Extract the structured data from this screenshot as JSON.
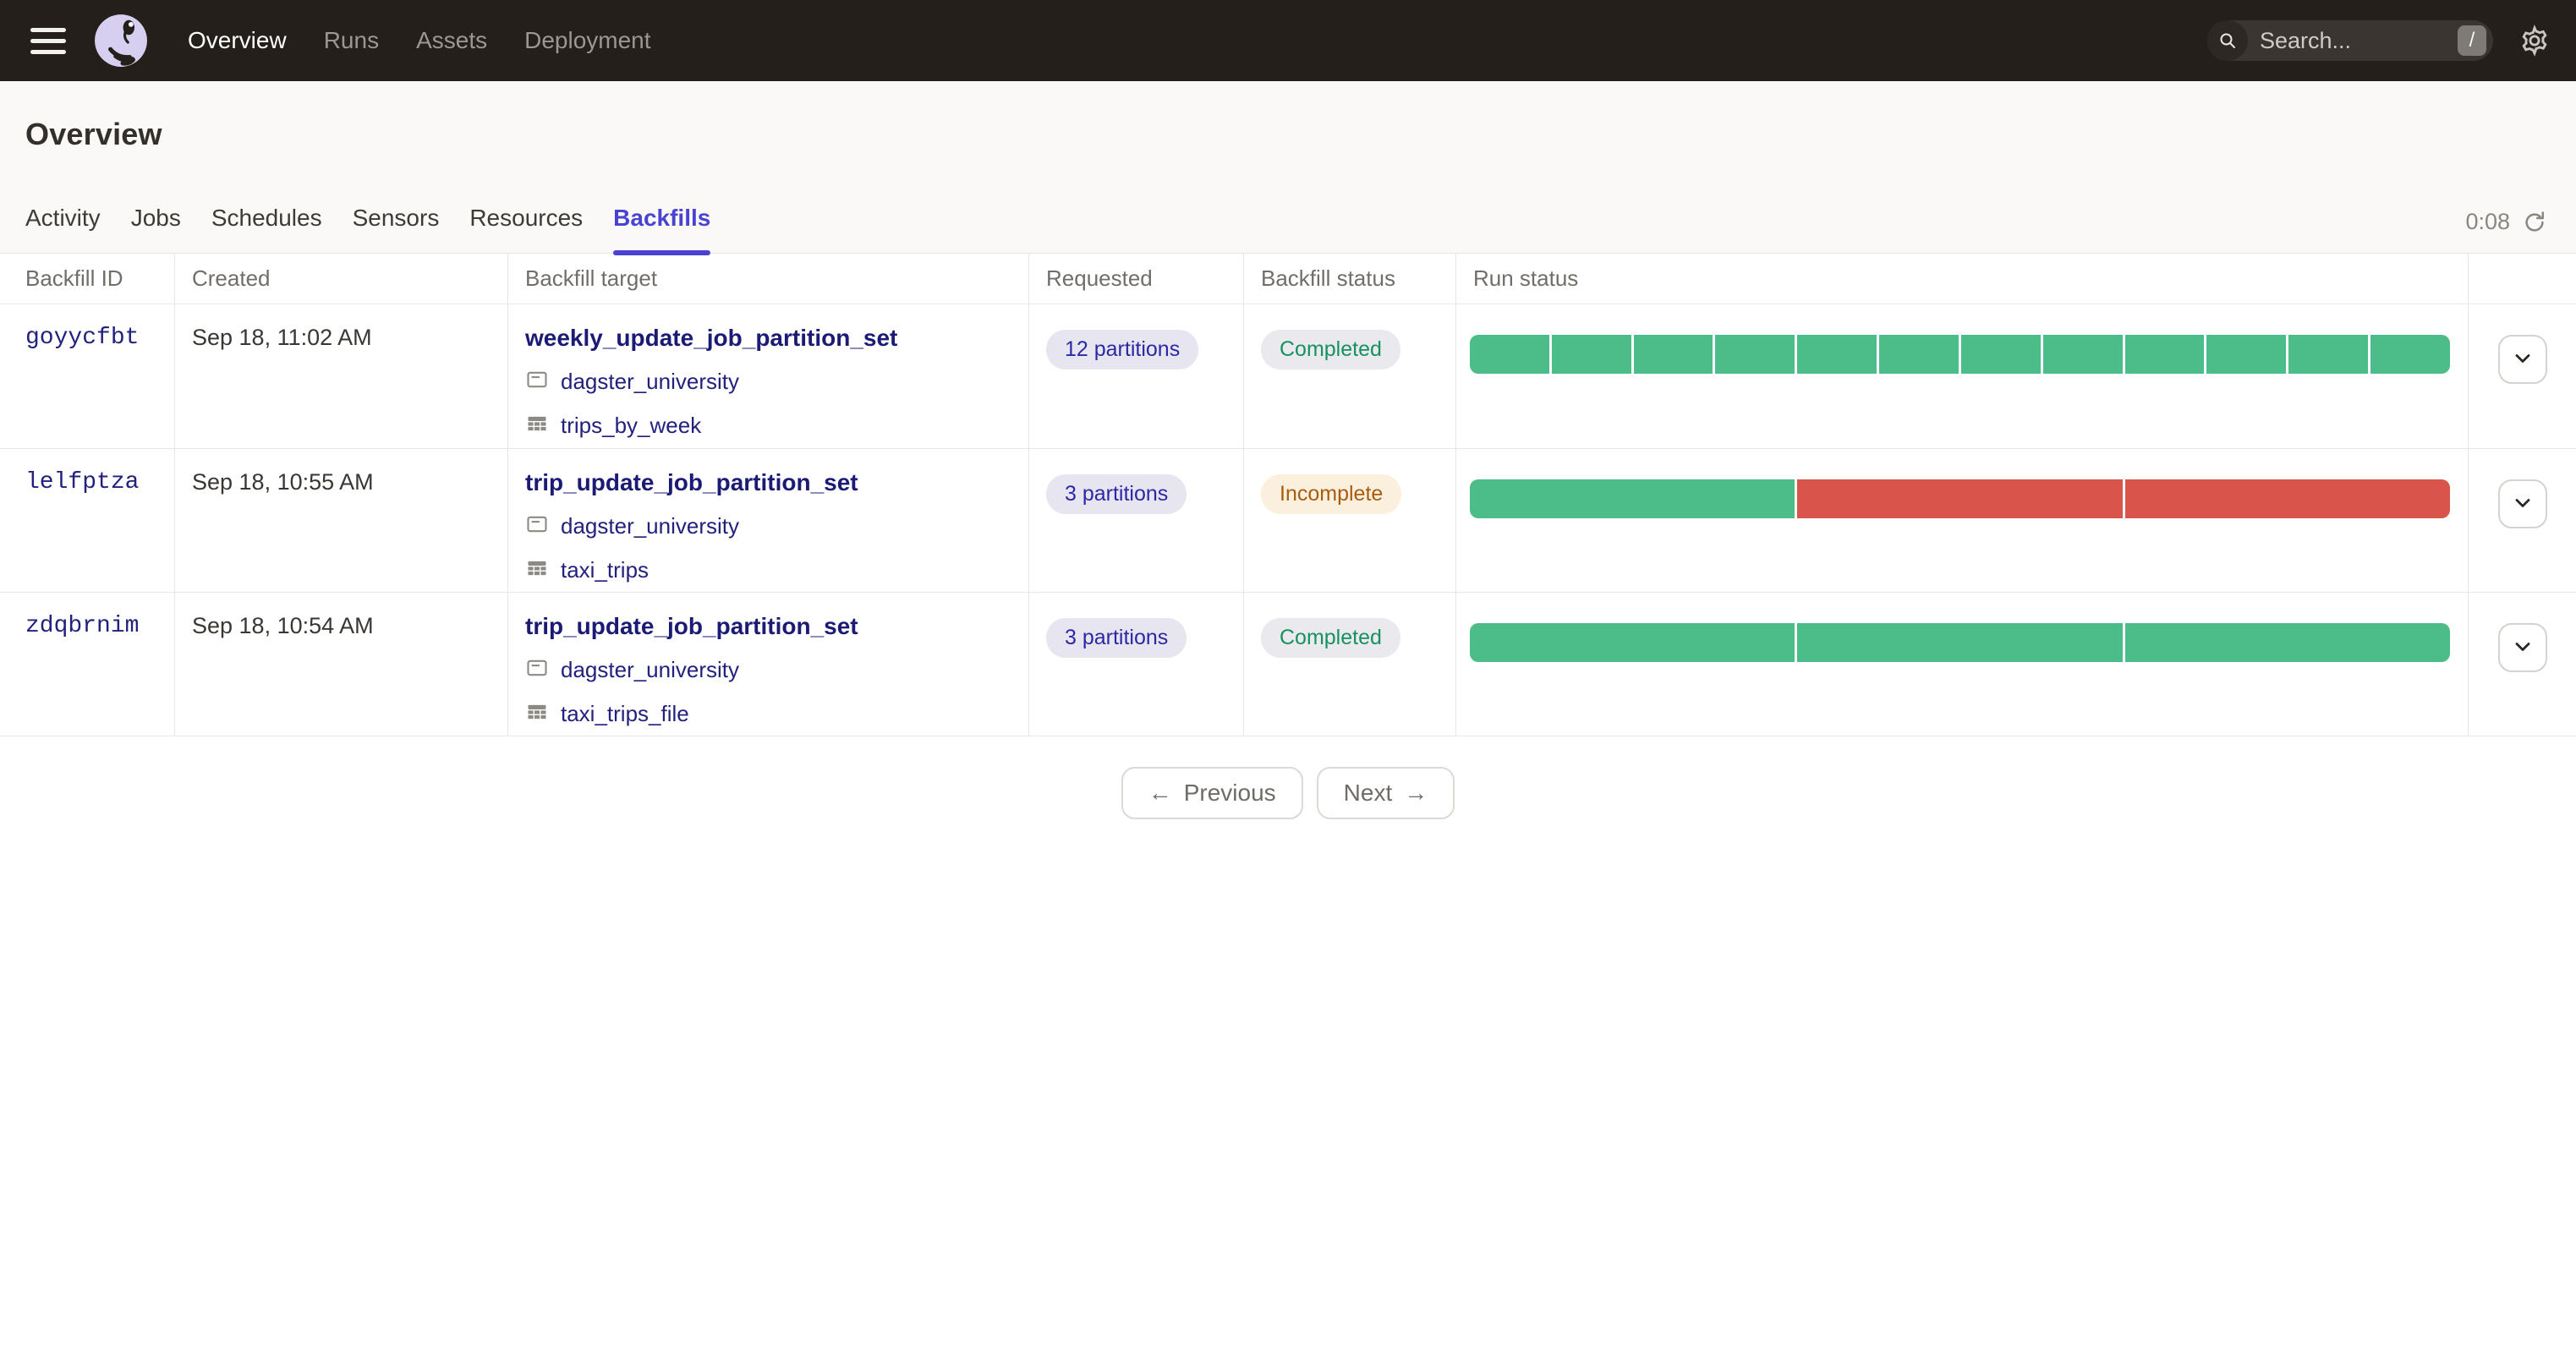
{
  "nav": {
    "links": [
      {
        "label": "Overview",
        "active": true
      },
      {
        "label": "Runs",
        "active": false
      },
      {
        "label": "Assets",
        "active": false
      },
      {
        "label": "Deployment",
        "active": false
      }
    ],
    "search": {
      "placeholder": "Search...",
      "shortcut_key": "/"
    }
  },
  "page": {
    "title": "Overview",
    "tabs": [
      "Activity",
      "Jobs",
      "Schedules",
      "Sensors",
      "Resources",
      "Backfills"
    ],
    "active_tab": "Backfills",
    "refresh_timer": "0:08"
  },
  "table": {
    "columns": [
      "Backfill ID",
      "Created",
      "Backfill target",
      "Requested",
      "Backfill status",
      "Run status"
    ],
    "rows": [
      {
        "id": "goyycfbt",
        "created": "Sep 18, 11:02 AM",
        "target": "weekly_update_job_partition_set",
        "project": "dagster_university",
        "asset": "trips_by_week",
        "requested": "12 partitions",
        "status": "Completed",
        "status_kind": "success",
        "run_segments": [
          "success",
          "success",
          "success",
          "success",
          "success",
          "success",
          "success",
          "success",
          "success",
          "success",
          "success",
          "success"
        ]
      },
      {
        "id": "lelfptza",
        "created": "Sep 18, 10:55 AM",
        "target": "trip_update_job_partition_set",
        "project": "dagster_university",
        "asset": "taxi_trips",
        "requested": "3 partitions",
        "status": "Incomplete",
        "status_kind": "warning",
        "run_segments": [
          "success",
          "failure",
          "failure"
        ]
      },
      {
        "id": "zdqbrnim",
        "created": "Sep 18, 10:54 AM",
        "target": "trip_update_job_partition_set",
        "project": "dagster_university",
        "asset": "taxi_trips_file",
        "requested": "3 partitions",
        "status": "Completed",
        "status_kind": "success",
        "run_segments": [
          "success",
          "success",
          "success"
        ]
      }
    ]
  },
  "pagination": {
    "prev_arrow": "←",
    "previous_label": "Previous",
    "next_label": "Next",
    "next_arrow": "→"
  },
  "colors": {
    "success_segment": "#4cbd89",
    "failure_segment": "#d9544a",
    "accent": "#4a43d2",
    "link_navy": "#23217e",
    "completed_text": "#16925c",
    "incomplete_text": "#a85c10"
  }
}
